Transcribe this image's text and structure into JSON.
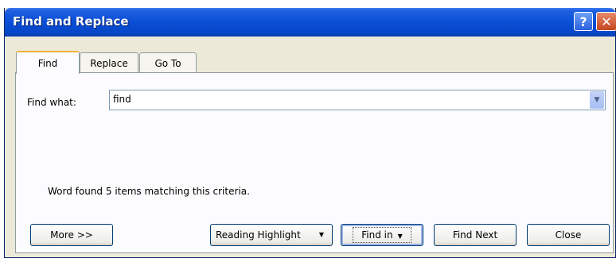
{
  "window": {
    "title": "Find and Replace",
    "help_label": "?",
    "close_label": "✕"
  },
  "tabs": [
    {
      "label": "Find",
      "active": true
    },
    {
      "label": "Replace",
      "active": false
    },
    {
      "label": "Go To",
      "active": false
    }
  ],
  "find_what": {
    "label": "Find what:",
    "value": "find"
  },
  "status": "Word found 5 items matching this criteria.",
  "buttons": {
    "more": "More >>",
    "reading_highlight": "Reading Highlight",
    "find_in": "Find in",
    "find_next": "Find Next",
    "close": "Close"
  },
  "icons": {
    "dropdown": "chevron-down-icon"
  }
}
